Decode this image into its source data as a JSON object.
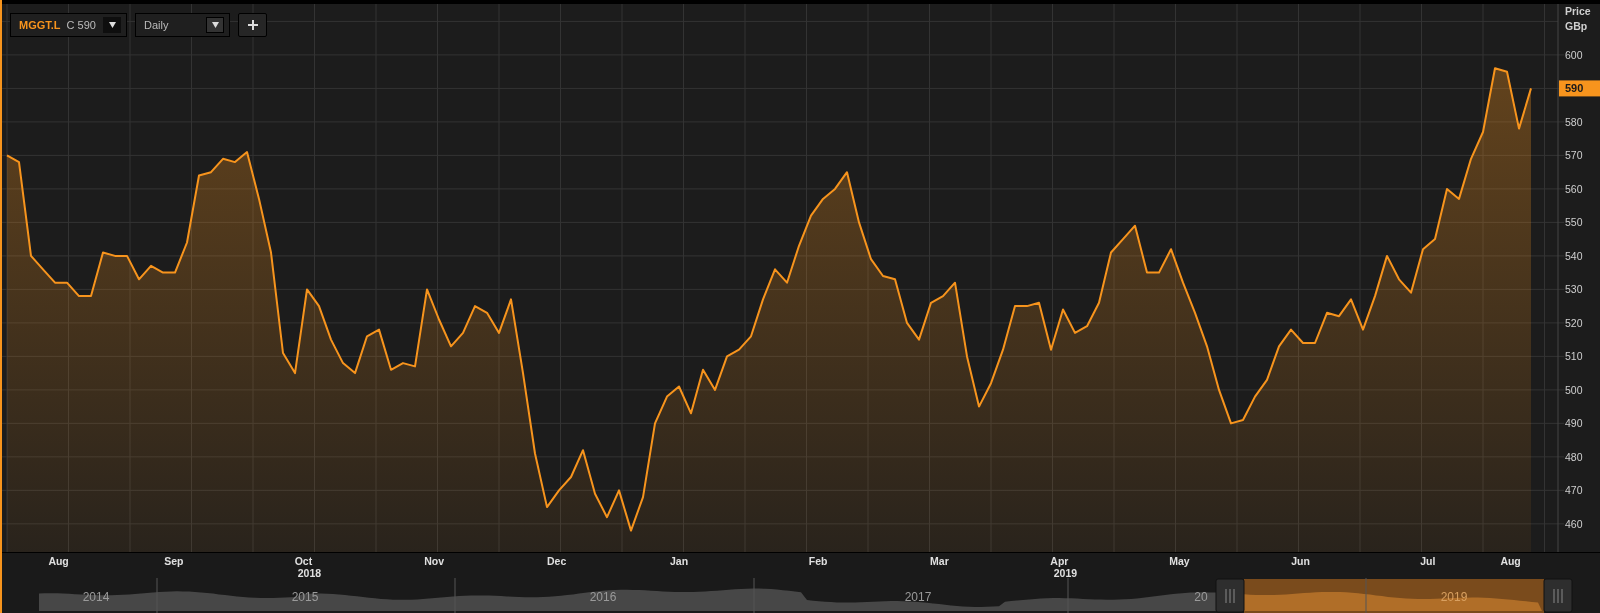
{
  "toolbar": {
    "quote": "C 590",
    "interval": "Daily"
  },
  "time_axis": {
    "months": [
      {
        "label": "Aug"
      },
      {
        "label": "Sep"
      },
      {
        "label": "Oct",
        "year": "2018"
      },
      {
        "label": "Nov"
      },
      {
        "label": "Dec"
      },
      {
        "label": "Jan"
      },
      {
        "label": "Feb"
      },
      {
        "label": "Mar"
      },
      {
        "label": "Apr",
        "year": "2019"
      },
      {
        "label": "May"
      },
      {
        "label": "Jun"
      },
      {
        "label": "Jul"
      },
      {
        "label": "Aug"
      }
    ]
  },
  "axis": {
    "title": "Price",
    "unit": "GBp",
    "last_price": "590"
  },
  "chart_data": {
    "type": "area",
    "grid": true,
    "ylim": [
      451.6,
      615.2
    ],
    "yticks": [
      460,
      470,
      480,
      490,
      500,
      510,
      520,
      530,
      540,
      550,
      560,
      570,
      580,
      590,
      600
    ],
    "series": [
      {
        "name": "MGGT.L",
        "color": "#f7941d",
        "values": [
          570,
          568,
          540,
          536,
          532,
          532,
          528,
          528,
          541,
          540,
          540,
          533,
          537,
          535,
          535,
          544,
          564,
          565,
          569,
          568,
          571,
          557,
          541,
          511,
          505,
          530,
          525,
          515,
          508,
          505,
          516,
          518,
          506,
          508,
          507,
          530,
          521,
          513,
          517,
          525,
          523,
          517,
          527,
          505,
          481,
          465,
          470,
          474,
          482,
          469,
          462,
          470,
          458,
          468,
          490,
          498,
          501,
          493,
          506,
          500,
          510,
          512,
          516,
          527,
          536,
          532,
          543,
          552,
          557,
          560,
          565,
          550,
          539,
          534,
          533,
          520,
          515,
          526,
          528,
          532,
          510,
          495,
          502,
          512,
          525,
          525,
          526,
          512,
          524,
          517,
          519,
          526,
          541,
          545,
          549,
          535,
          535,
          542,
          532,
          523,
          513,
          500,
          490,
          491,
          498,
          503,
          513,
          518,
          514,
          514,
          523,
          522,
          527,
          518,
          528,
          540,
          533,
          529,
          542,
          545,
          560,
          557,
          569,
          577,
          596,
          595,
          578,
          590
        ]
      }
    ]
  },
  "navigator": {
    "years": [
      {
        "label": "2014",
        "selected": false
      },
      {
        "label": "2015",
        "selected": false
      },
      {
        "label": "2016",
        "selected": false
      },
      {
        "label": "2017",
        "selected": false
      },
      {
        "label": "20",
        "selected": false
      },
      {
        "label": "2019",
        "selected": true
      }
    ]
  }
}
